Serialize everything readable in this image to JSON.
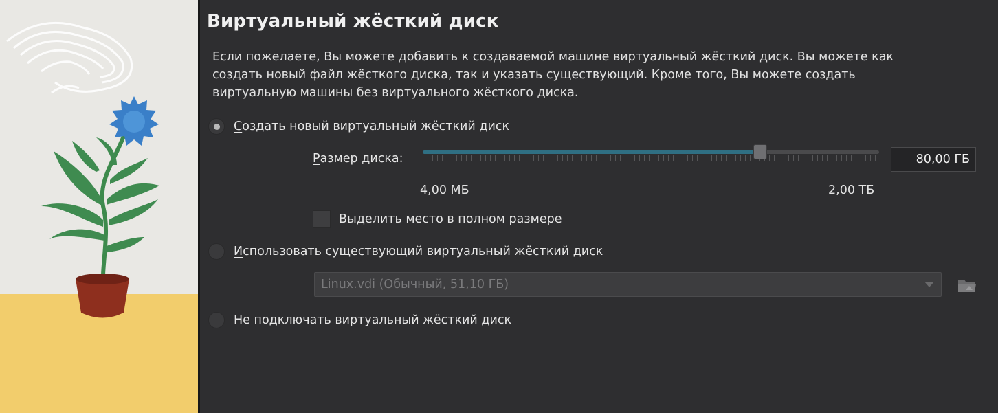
{
  "title": "Виртуальный жёсткий диск",
  "description": "Если пожелаете, Вы можете добавить к создаваемой машине виртуальный жёсткий диск. Вы можете как создать новый файл жёсткого диска, так и указать существующий. Кроме того, Вы можете создать виртуальную машины без виртуального жёсткого диска.",
  "options": {
    "create_new": {
      "mnemonic": "С",
      "rest": "оздать новый виртуальный жёсткий диск",
      "selected": true
    },
    "use_existing": {
      "mnemonic": "И",
      "rest": "спользовать существующий виртуальный жёсткий диск",
      "selected": false
    },
    "no_disk": {
      "mnemonic": "Н",
      "rest": "е подключать виртуальный жёсткий диск",
      "selected": false
    }
  },
  "disk_size": {
    "label_mnemonic": "Р",
    "label_rest": "азмер диска:",
    "value_text": "80,00 ГБ",
    "slider_fraction": 0.74,
    "min_label": "4,00 МБ",
    "max_label": "2,00 ТБ"
  },
  "preallocate": {
    "pre": "Выделить место в ",
    "mnemonic": "п",
    "post": "олном размере",
    "checked": false
  },
  "existing_disk": {
    "selected_value": "Linux.vdi (Обычный, 51,10 ГБ)"
  },
  "colors": {
    "accent": "#2f6f83",
    "background": "#2e2e30"
  },
  "icons": {
    "folder_button": "folder-open-icon"
  }
}
